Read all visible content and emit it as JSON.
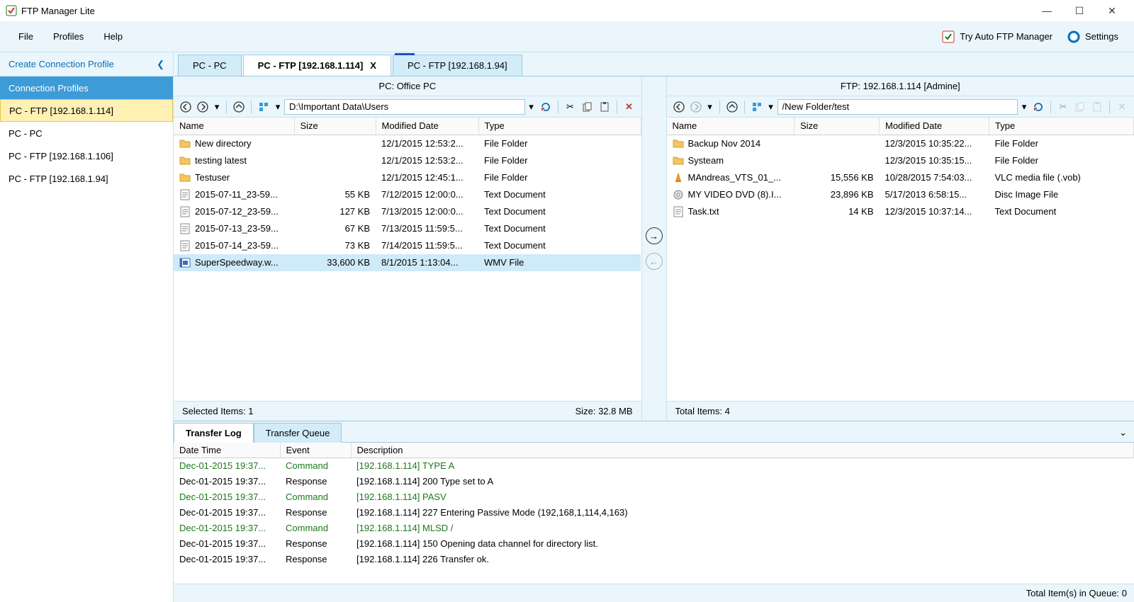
{
  "app": {
    "title": "FTP Manager Lite"
  },
  "menu": {
    "file": "File",
    "profiles": "Profiles",
    "help": "Help",
    "try_auto": "Try Auto FTP Manager",
    "settings": "Settings"
  },
  "sidebar": {
    "create_link": "Create Connection Profile",
    "header": "Connection Profiles",
    "items": [
      {
        "label": "PC - FTP [192.168.1.114]",
        "selected": true
      },
      {
        "label": "PC - PC",
        "selected": false
      },
      {
        "label": "PC - FTP [192.168.1.106]",
        "selected": false
      },
      {
        "label": "PC - FTP [192.168.1.94]",
        "selected": false
      }
    ]
  },
  "tabs": [
    {
      "label": "PC - PC",
      "active": false
    },
    {
      "label": "PC - FTP [192.168.1.114]",
      "active": true,
      "closeable": true
    },
    {
      "label": "PC - FTP [192.168.1.94]",
      "active": false,
      "loading": true
    }
  ],
  "left_pane": {
    "header": "PC: Office PC",
    "path": "D:\\Important Data\\Users",
    "columns": [
      "Name",
      "Size",
      "Modified Date",
      "Type"
    ],
    "rows": [
      {
        "icon": "folder",
        "name": "New directory",
        "size": "",
        "date": "12/1/2015 12:53:2...",
        "type": "File Folder"
      },
      {
        "icon": "folder",
        "name": "testing latest",
        "size": "",
        "date": "12/1/2015 12:53:2...",
        "type": "File Folder"
      },
      {
        "icon": "folder",
        "name": "Testuser",
        "size": "",
        "date": "12/1/2015 12:45:1...",
        "type": "File Folder"
      },
      {
        "icon": "txt",
        "name": "2015-07-11_23-59...",
        "size": "55 KB",
        "date": "7/12/2015 12:00:0...",
        "type": "Text Document"
      },
      {
        "icon": "txt",
        "name": "2015-07-12_23-59...",
        "size": "127 KB",
        "date": "7/13/2015 12:00:0...",
        "type": "Text Document"
      },
      {
        "icon": "txt",
        "name": "2015-07-13_23-59...",
        "size": "67 KB",
        "date": "7/13/2015 11:59:5...",
        "type": "Text Document"
      },
      {
        "icon": "txt",
        "name": "2015-07-14_23-59...",
        "size": "73 KB",
        "date": "7/14/2015 11:59:5...",
        "type": "Text Document"
      },
      {
        "icon": "wmv",
        "name": "SuperSpeedway.w...",
        "size": "33,600 KB",
        "date": "8/1/2015 1:13:04...",
        "type": "WMV File",
        "selected": true
      }
    ],
    "status_left": "Selected Items: 1",
    "status_right": "Size: 32.8 MB"
  },
  "right_pane": {
    "header": "FTP: 192.168.1.114 [Admine]",
    "path": "/New Folder/test",
    "columns": [
      "Name",
      "Size",
      "Modified Date",
      "Type"
    ],
    "rows": [
      {
        "icon": "folder",
        "name": "Backup Nov 2014",
        "size": "",
        "date": "12/3/2015 10:35:22...",
        "type": "File Folder"
      },
      {
        "icon": "folder",
        "name": "Systeam",
        "size": "",
        "date": "12/3/2015 10:35:15...",
        "type": "File Folder"
      },
      {
        "icon": "vlc",
        "name": "MAndreas_VTS_01_...",
        "size": "15,556 KB",
        "date": "10/28/2015 7:54:03...",
        "type": "VLC media file (.vob)"
      },
      {
        "icon": "iso",
        "name": "MY VIDEO DVD (8).I...",
        "size": "23,896 KB",
        "date": "5/17/2013 6:58:15...",
        "type": "Disc Image File"
      },
      {
        "icon": "txt",
        "name": "Task.txt",
        "size": "14 KB",
        "date": "12/3/2015 10:37:14...",
        "type": "Text Document"
      }
    ],
    "status_left": "Total Items: 4",
    "status_right": ""
  },
  "bottom": {
    "tab_log": "Transfer Log",
    "tab_queue": "Transfer Queue",
    "columns": [
      "Date Time",
      "Event",
      "Description"
    ],
    "rows": [
      {
        "kind": "cmd",
        "dt": "Dec-01-2015 19:37...",
        "event": "Command",
        "desc": "[192.168.1.114] TYPE A"
      },
      {
        "kind": "resp",
        "dt": "Dec-01-2015 19:37...",
        "event": "Response",
        "desc": "[192.168.1.114] 200 Type set to A"
      },
      {
        "kind": "cmd",
        "dt": "Dec-01-2015 19:37...",
        "event": "Command",
        "desc": "[192.168.1.114] PASV"
      },
      {
        "kind": "resp",
        "dt": "Dec-01-2015 19:37...",
        "event": "Response",
        "desc": "[192.168.1.114] 227 Entering Passive Mode (192,168,1,114,4,163)"
      },
      {
        "kind": "cmd",
        "dt": "Dec-01-2015 19:37...",
        "event": "Command",
        "desc": "[192.168.1.114] MLSD /"
      },
      {
        "kind": "resp",
        "dt": "Dec-01-2015 19:37...",
        "event": "Response",
        "desc": "[192.168.1.114] 150 Opening data channel for directory list."
      },
      {
        "kind": "resp",
        "dt": "Dec-01-2015 19:37...",
        "event": "Response",
        "desc": "[192.168.1.114] 226 Transfer ok."
      }
    ]
  },
  "statusbar": {
    "queue": "Total Item(s) in Queue: 0"
  }
}
